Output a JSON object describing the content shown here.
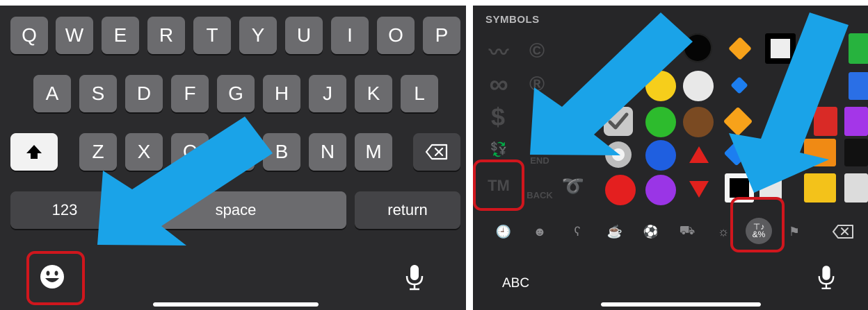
{
  "keyboard": {
    "row1": [
      "Q",
      "W",
      "E",
      "R",
      "T",
      "Y",
      "U",
      "I",
      "O",
      "P"
    ],
    "row2": [
      "A",
      "S",
      "D",
      "F",
      "G",
      "H",
      "J",
      "K",
      "L"
    ],
    "row3": [
      "Z",
      "X",
      "C",
      "V",
      "B",
      "N",
      "M"
    ],
    "numbers_label": "123",
    "space_label": "space",
    "return_label": "return"
  },
  "emoji_keyboard": {
    "section_title": "SYMBOLS",
    "abc_label": "ABC",
    "tm_symbol": "TM",
    "symbols": [
      "〰",
      "©",
      "∞",
      "®",
      "$",
      "💱",
      "⏫",
      "END",
      "BACK"
    ],
    "category_icons": [
      "clock-icon",
      "smiley-icon",
      "bear-icon",
      "food-icon",
      "ball-icon",
      "car-icon",
      "bulb-icon",
      "symbols-icon",
      "flag-icon"
    ]
  },
  "colors": {
    "highlight": "#d0161d",
    "arrow": "#1aa3e8",
    "key": "#6b6b6e",
    "background": "#2b2b2d"
  }
}
